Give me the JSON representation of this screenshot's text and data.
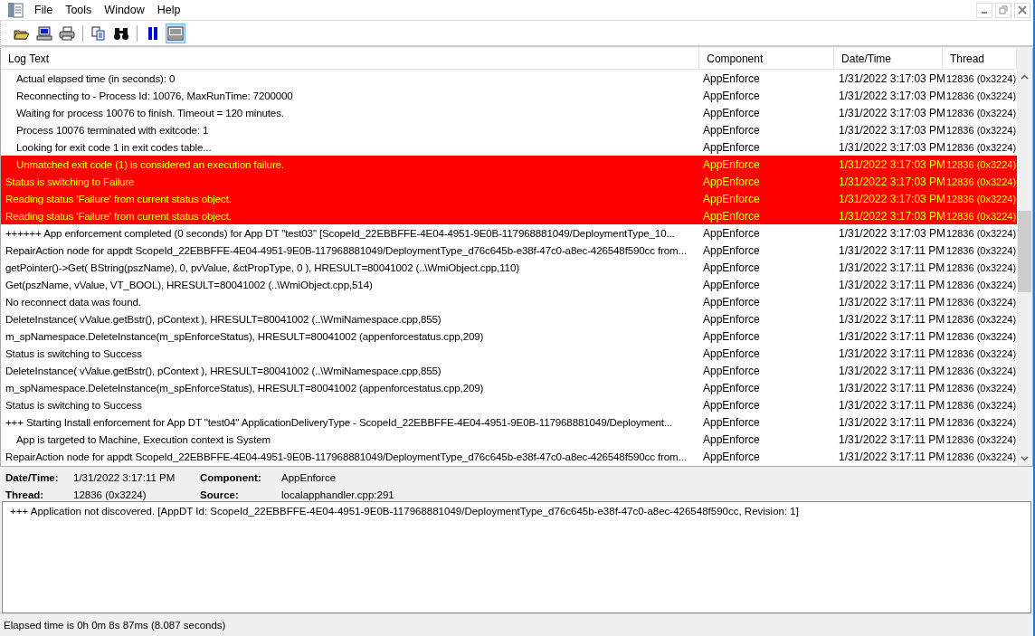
{
  "menu": [
    "File",
    "Tools",
    "Window",
    "Help"
  ],
  "toolbar": [
    {
      "kind": "open",
      "selected": false
    },
    {
      "kind": "computer",
      "selected": false
    },
    {
      "kind": "print",
      "selected": false
    },
    {
      "kind": "sep"
    },
    {
      "kind": "copy",
      "selected": false
    },
    {
      "kind": "find",
      "selected": false
    },
    {
      "kind": "sep"
    },
    {
      "kind": "pause",
      "selected": false
    },
    {
      "kind": "view",
      "selected": true
    }
  ],
  "table": {
    "columns": [
      "Log Text",
      "Component",
      "Date/Time",
      "Thread"
    ],
    "rows": [
      {
        "text": "Actual elapsed time (in seconds): 0",
        "indented": true,
        "error": false,
        "component": "AppEnforce",
        "time": "1/31/2022 3:17:03 PM",
        "thread": "12836 (0x3224)"
      },
      {
        "text": "Reconnecting to - Process Id: 10076, MaxRunTime: 7200000",
        "indented": true,
        "error": false,
        "component": "AppEnforce",
        "time": "1/31/2022 3:17:03 PM",
        "thread": "12836 (0x3224)"
      },
      {
        "text": "Waiting for process 10076 to finish.  Timeout = 120 minutes.",
        "indented": true,
        "error": false,
        "component": "AppEnforce",
        "time": "1/31/2022 3:17:03 PM",
        "thread": "12836 (0x3224)"
      },
      {
        "text": "Process 10076 terminated with exitcode: 1",
        "indented": true,
        "error": false,
        "component": "AppEnforce",
        "time": "1/31/2022 3:17:03 PM",
        "thread": "12836 (0x3224)"
      },
      {
        "text": "Looking for exit code 1 in exit codes table...",
        "indented": true,
        "error": false,
        "component": "AppEnforce",
        "time": "1/31/2022 3:17:03 PM",
        "thread": "12836 (0x3224)"
      },
      {
        "text": "Unmatched exit code (1) is considered an execution failure.",
        "indented": true,
        "error": true,
        "component": "AppEnforce",
        "time": "1/31/2022 3:17:03 PM",
        "thread": "12836 (0x3224)"
      },
      {
        "text": "Status is switching to Failure",
        "indented": false,
        "error": true,
        "component": "AppEnforce",
        "time": "1/31/2022 3:17:03 PM",
        "thread": "12836 (0x3224)"
      },
      {
        "text": "Reading status 'Failure' from current status object.",
        "indented": false,
        "error": true,
        "component": "AppEnforce",
        "time": "1/31/2022 3:17:03 PM",
        "thread": "12836 (0x3224)"
      },
      {
        "text": "Reading status 'Failure' from current status object.",
        "indented": false,
        "error": true,
        "component": "AppEnforce",
        "time": "1/31/2022 3:17:03 PM",
        "thread": "12836 (0x3224)"
      },
      {
        "text": "++++++ App enforcement completed (0 seconds) for App DT \"test03\" [ScopeId_22EBBFFE-4E04-4951-9E0B-117968881049/DeploymentType_10...",
        "indented": false,
        "error": false,
        "component": "AppEnforce",
        "time": "1/31/2022 3:17:03 PM",
        "thread": "12836 (0x3224)"
      },
      {
        "text": "RepairAction node for appdt ScopeId_22EBBFFE-4E04-4951-9E0B-117968881049/DeploymentType_d76c645b-e38f-47c0-a8ec-426548f590cc from...",
        "indented": false,
        "error": false,
        "component": "AppEnforce",
        "time": "1/31/2022 3:17:11 PM",
        "thread": "12836 (0x3224)"
      },
      {
        "text": "getPointer()->Get( BString(pszName), 0, pvValue, &ctPropType, 0 ), HRESULT=80041002 (..\\WmiObject.cpp,110)",
        "indented": false,
        "error": false,
        "component": "AppEnforce",
        "time": "1/31/2022 3:17:11 PM",
        "thread": "12836 (0x3224)"
      },
      {
        "text": "Get(pszName, vValue, VT_BOOL), HRESULT=80041002 (..\\WmiObject.cpp,514)",
        "indented": false,
        "error": false,
        "component": "AppEnforce",
        "time": "1/31/2022 3:17:11 PM",
        "thread": "12836 (0x3224)"
      },
      {
        "text": "No reconnect data was found.",
        "indented": false,
        "error": false,
        "component": "AppEnforce",
        "time": "1/31/2022 3:17:11 PM",
        "thread": "12836 (0x3224)"
      },
      {
        "text": "DeleteInstance( vValue.getBstr(), pContext ), HRESULT=80041002 (..\\WmiNamespace.cpp,855)",
        "indented": false,
        "error": false,
        "component": "AppEnforce",
        "time": "1/31/2022 3:17:11 PM",
        "thread": "12836 (0x3224)"
      },
      {
        "text": "m_spNamespace.DeleteInstance(m_spEnforceStatus), HRESULT=80041002 (appenforcestatus.cpp,209)",
        "indented": false,
        "error": false,
        "component": "AppEnforce",
        "time": "1/31/2022 3:17:11 PM",
        "thread": "12836 (0x3224)"
      },
      {
        "text": "Status is switching to Success",
        "indented": false,
        "error": false,
        "component": "AppEnforce",
        "time": "1/31/2022 3:17:11 PM",
        "thread": "12836 (0x3224)"
      },
      {
        "text": "DeleteInstance( vValue.getBstr(), pContext ), HRESULT=80041002 (..\\WmiNamespace.cpp,855)",
        "indented": false,
        "error": false,
        "component": "AppEnforce",
        "time": "1/31/2022 3:17:11 PM",
        "thread": "12836 (0x3224)"
      },
      {
        "text": "m_spNamespace.DeleteInstance(m_spEnforceStatus), HRESULT=80041002 (appenforcestatus.cpp,209)",
        "indented": false,
        "error": false,
        "component": "AppEnforce",
        "time": "1/31/2022 3:17:11 PM",
        "thread": "12836 (0x3224)"
      },
      {
        "text": "Status is switching to Success",
        "indented": false,
        "error": false,
        "component": "AppEnforce",
        "time": "1/31/2022 3:17:11 PM",
        "thread": "12836 (0x3224)"
      },
      {
        "text": "+++ Starting Install enforcement for App DT \"test04\" ApplicationDeliveryType - ScopeId_22EBBFFE-4E04-4951-9E0B-117968881049/Deployment...",
        "indented": false,
        "error": false,
        "component": "AppEnforce",
        "time": "1/31/2022 3:17:11 PM",
        "thread": "12836 (0x3224)"
      },
      {
        "text": "App is targeted to Machine, Execution context is System",
        "indented": true,
        "error": false,
        "component": "AppEnforce",
        "time": "1/31/2022 3:17:11 PM",
        "thread": "12836 (0x3224)"
      },
      {
        "text": "RepairAction node for appdt ScopeId_22EBBFFE-4E04-4951-9E0B-117968881049/DeploymentType_d76c645b-e38f-47c0-a8ec-426548f590cc from...",
        "indented": false,
        "error": false,
        "component": "AppEnforce",
        "time": "1/31/2022 3:17:11 PM",
        "thread": "12836 (0x3224)"
      }
    ]
  },
  "details": [
    {
      "label": "Date/Time:",
      "value": "1/31/2022 3:17:11 PM"
    },
    {
      "label": "Component:",
      "value": "AppEnforce"
    },
    {
      "label": "Thread:",
      "value": "12836 (0x3224)"
    },
    {
      "label": "Source:",
      "value": "localapphandler.cpp:291"
    }
  ],
  "message": "+++ Application not discovered. [AppDT Id: ScopeId_22EBBFFE-4E04-4951-9E0B-117968881049/DeploymentType_d76c645b-e38f-47c0-a8ec-426548f590cc, Revision: 1]",
  "status_bar": "Elapsed time is 0h 0m 8s 87ms (8.087 seconds)"
}
